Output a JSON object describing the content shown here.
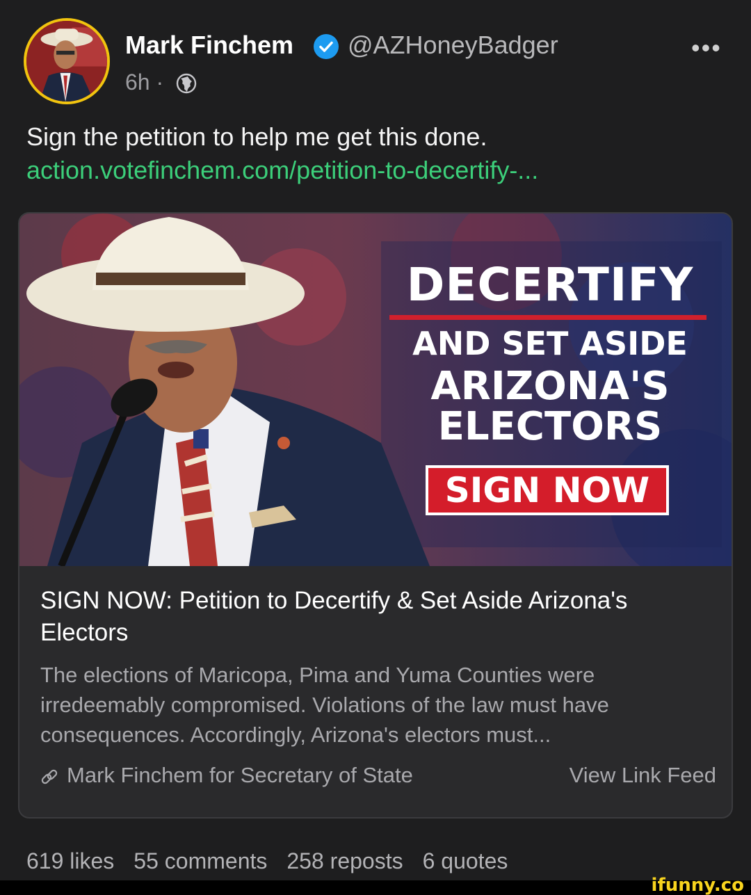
{
  "author": {
    "name": "Mark Finchem",
    "handle": "@AZHoneyBadger",
    "time": "6h ·"
  },
  "post": {
    "text": "Sign the petition to help me get this done.",
    "link": "action.votefinchem.com/petition-to-decertify-..."
  },
  "card": {
    "banner": {
      "line1": "DECERTIFY",
      "line2": "AND SET ASIDE",
      "line3": "ARIZONA'S",
      "line4": "ELECTORS",
      "button": "SIGN NOW"
    },
    "title": "SIGN NOW: Petition to Decertify & Set Aside Arizona's Electors",
    "description": "The elections of Maricopa, Pima and Yuma Counties were irredeemably compromised. Violations of the law must have consequences. Accordingly, Arizona's electors must...",
    "source": "Mark Finchem for Secretary of State",
    "view_feed": "View Link Feed"
  },
  "stats": {
    "likes": "619 likes",
    "comments": "55 comments",
    "reposts": "258 reposts",
    "quotes": "6 quotes"
  },
  "watermark": "ifunny.co",
  "colors": {
    "background": "#1e1e1f",
    "link": "#3ccf7a",
    "verified": "#1d9bf0",
    "avatar_ring": "#f1c40f",
    "banner_red": "#d41d2a"
  },
  "icons": [
    "verified-badge-icon",
    "globe-icon",
    "more-options-icon",
    "link-icon"
  ]
}
